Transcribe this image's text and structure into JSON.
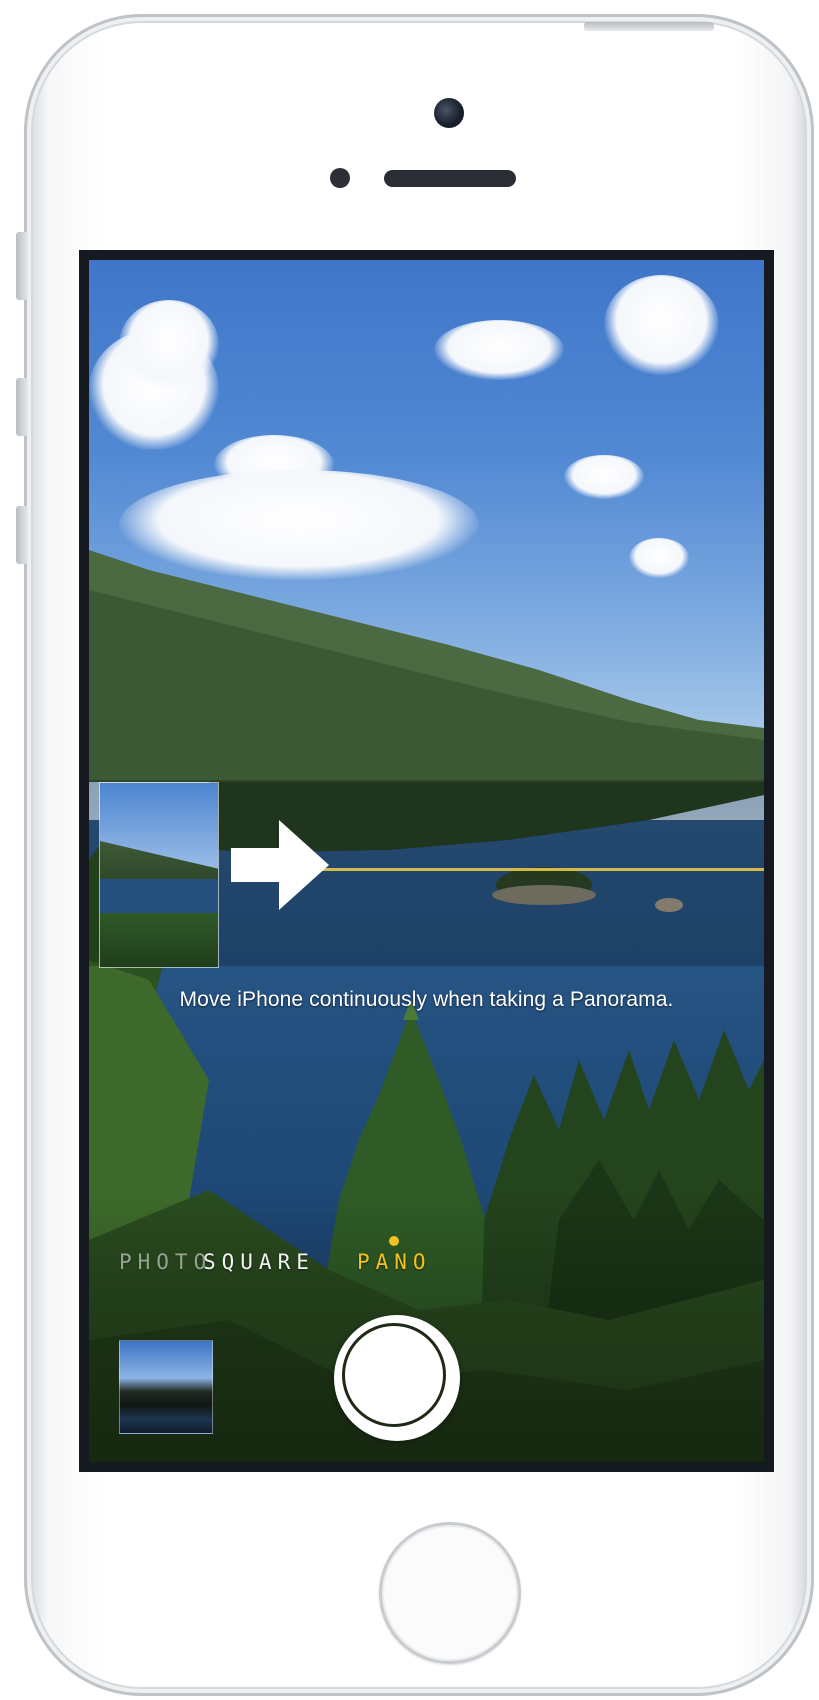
{
  "device": "iPhone",
  "camera": {
    "hint_text": "Move iPhone continuously when taking a Panorama.",
    "modes": [
      {
        "label": "PHOTO",
        "selected": false
      },
      {
        "label": "SQUARE",
        "selected": false
      },
      {
        "label": "PANO",
        "selected": true
      }
    ],
    "active_mode_color": "#f2c021",
    "icons": [
      "pano-direction-arrow-icon",
      "shutter-button",
      "gallery-thumbnail",
      "home-button"
    ]
  }
}
